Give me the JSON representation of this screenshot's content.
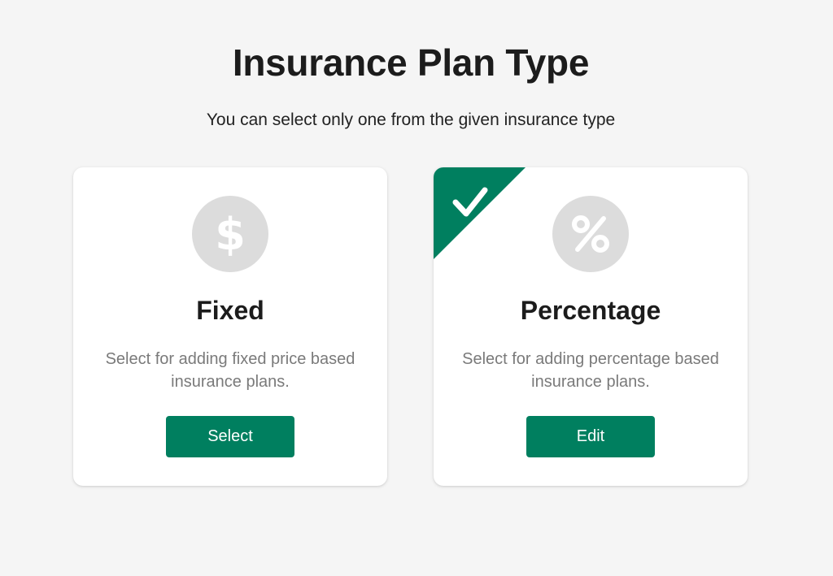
{
  "header": {
    "title": "Insurance Plan Type",
    "subtitle": "You can select only one from the given insurance type"
  },
  "cards": [
    {
      "icon": "dollar-icon",
      "title": "Fixed",
      "description": "Select for adding fixed price based insurance plans.",
      "button_label": "Select",
      "selected": false
    },
    {
      "icon": "percent-icon",
      "title": "Percentage",
      "description": "Select for adding percentage based insurance plans.",
      "button_label": "Edit",
      "selected": true
    }
  ],
  "colors": {
    "accent": "#007f5f",
    "icon_background": "#dcdcdc",
    "page_background": "#f5f5f5"
  }
}
